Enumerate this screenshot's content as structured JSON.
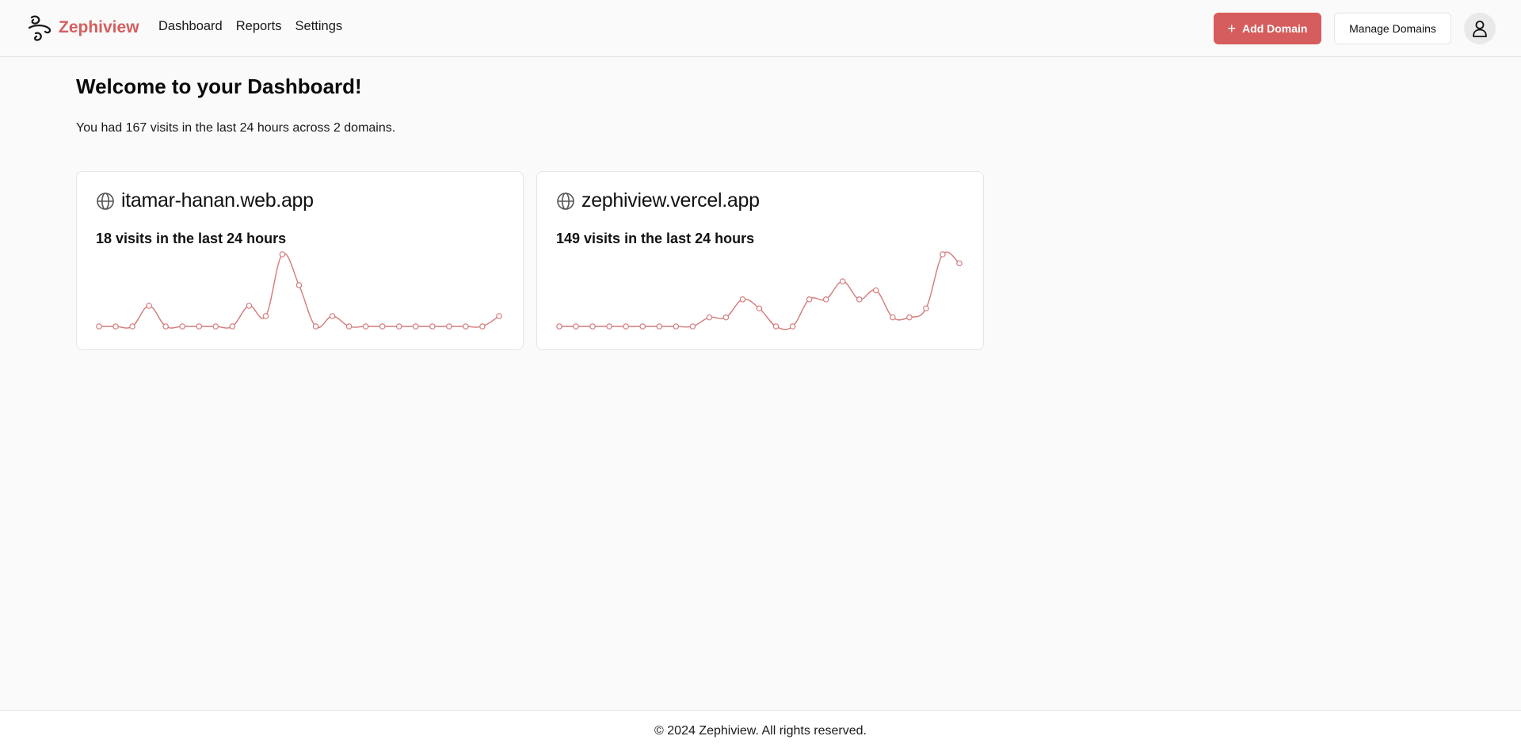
{
  "brand": {
    "name": "Zephiview",
    "logo_icon": "wind-swirl-icon"
  },
  "nav": {
    "items": [
      "Dashboard",
      "Reports",
      "Settings"
    ]
  },
  "header": {
    "add_domain_label": "Add Domain",
    "manage_domains_label": "Manage Domains",
    "avatar_icon": "user-icon"
  },
  "main": {
    "title": "Welcome to your Dashboard!",
    "summary": "You had 167 visits in the last 24 hours across 2 domains."
  },
  "colors": {
    "accent": "#d65d5d",
    "line": "#d47a7a"
  },
  "chart_data": [
    {
      "type": "line",
      "title": "itamar-hanan.web.app",
      "subtitle": "18 visits in the last 24 hours",
      "values": [
        0,
        0,
        0,
        2,
        0,
        0,
        0,
        0,
        0,
        2,
        1,
        7,
        4,
        0,
        1,
        0,
        0,
        0,
        0,
        0,
        0,
        0,
        0,
        0,
        1
      ],
      "ylim": [
        0,
        7
      ]
    },
    {
      "type": "line",
      "title": "zephiview.vercel.app",
      "subtitle": "149 visits in the last 24 hours",
      "values": [
        0,
        0,
        0,
        0,
        0,
        0,
        0,
        0,
        0,
        1,
        1,
        3,
        2,
        0,
        0,
        3,
        3,
        5,
        3,
        4,
        1,
        1,
        2,
        8,
        7
      ],
      "ylim": [
        0,
        8
      ]
    }
  ],
  "footer": {
    "text": "© 2024 Zephiview. All rights reserved."
  }
}
